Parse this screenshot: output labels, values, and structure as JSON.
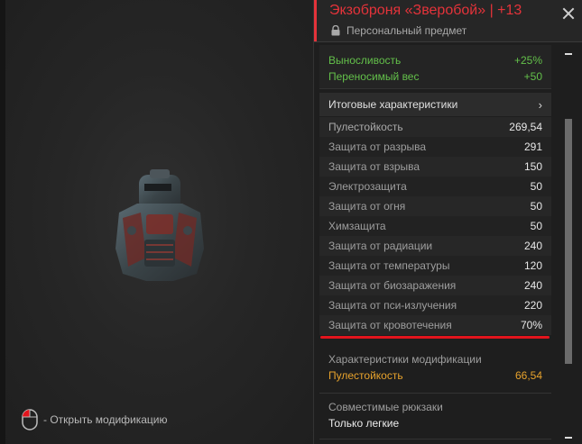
{
  "preview": {
    "hint_text": "- Открыть модификацию",
    "mouse_icon": "mouse-left-click-icon",
    "armor_icon": "exoskeleton-armor-image"
  },
  "item": {
    "title": "Экзоброня «Зверобой» | +13",
    "subtitle": "Персональный предмет",
    "lock_icon": "lock-icon",
    "accent_color": "#e4333a"
  },
  "bonuses": [
    {
      "name": "Выносливость",
      "value": "+25%"
    },
    {
      "name": "Переносимый вес",
      "value": "+50"
    }
  ],
  "summary_section": {
    "label": "Итоговые характеристики",
    "chevron": "chevron-right-icon"
  },
  "stats": [
    {
      "name": "Пулестойкость",
      "value": "269,54"
    },
    {
      "name": "Защита от разрыва",
      "value": "291"
    },
    {
      "name": "Защита от взрыва",
      "value": "150"
    },
    {
      "name": "Электрозащита",
      "value": "50"
    },
    {
      "name": "Защита от огня",
      "value": "50"
    },
    {
      "name": "Химзащита",
      "value": "50"
    },
    {
      "name": "Защита от радиации",
      "value": "240"
    },
    {
      "name": "Защита от температуры",
      "value": "120"
    },
    {
      "name": "Защита от биозаражения",
      "value": "240"
    },
    {
      "name": "Защита от пси-излучения",
      "value": "220"
    },
    {
      "name": "Защита от кровотечения",
      "value": "70%"
    }
  ],
  "modifications": {
    "header": "Характеристики модификации",
    "stat_name": "Пулестойкость",
    "stat_value": "66,54",
    "color": "#e7a22c"
  },
  "backpacks": {
    "header": "Совместимые рюкзаки",
    "value": "Только легкие"
  },
  "colors": {
    "bonus_green": "#63c04a",
    "highlight_red": "#e2141d"
  }
}
